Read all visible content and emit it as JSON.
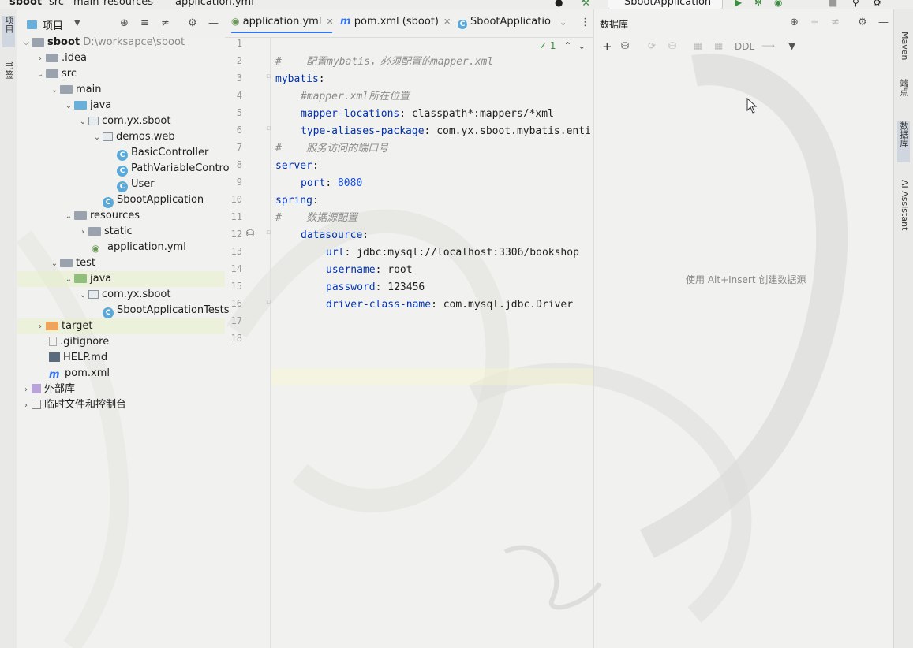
{
  "topbar": {
    "crumbs": [
      "sboot",
      "src",
      "main",
      "resources",
      "application.yml"
    ],
    "run_config": "SbootApplication"
  },
  "left_stripe": {
    "project_tab": "项目",
    "bookmarks_tab": "书签"
  },
  "project_panel": {
    "title": "项目",
    "tree": [
      {
        "label": "sboot",
        "hint": "D:\\worksapce\\sboot"
      },
      {
        "label": ".idea"
      },
      {
        "label": "src"
      },
      {
        "label": "main"
      },
      {
        "label": "java"
      },
      {
        "label": "com.yx.sboot"
      },
      {
        "label": "demos.web"
      },
      {
        "label": "BasicController"
      },
      {
        "label": "PathVariableContro"
      },
      {
        "label": "User"
      },
      {
        "label": "SbootApplication"
      },
      {
        "label": "resources"
      },
      {
        "label": "static"
      },
      {
        "label": "application.yml"
      },
      {
        "label": "test"
      },
      {
        "label": "java"
      },
      {
        "label": "com.yx.sboot"
      },
      {
        "label": "SbootApplicationTests"
      },
      {
        "label": "target"
      },
      {
        "label": ".gitignore"
      },
      {
        "label": "HELP.md"
      },
      {
        "label": "pom.xml"
      },
      {
        "label": "外部库"
      },
      {
        "label": "临时文件和控制台"
      }
    ]
  },
  "editor": {
    "tabs": [
      {
        "label": "application.yml"
      },
      {
        "label": "pom.xml (sboot)"
      },
      {
        "label": "SbootApplicatio"
      }
    ],
    "problems": "1",
    "line_numbers": [
      "1",
      "2",
      "3",
      "4",
      "5",
      "6",
      "7",
      "8",
      "9",
      "10",
      "11",
      "12",
      "13",
      "14",
      "15",
      "16",
      "17",
      "18"
    ],
    "code": {
      "l2": "#    配置mybatis，必须配置的mapper.xml",
      "l3": "mybatis",
      "l4": "#mapper.xml所在位置",
      "l5k": "mapper-locations",
      "l5v": "classpath*:mappers/*xml",
      "l6k": "type-aliases-package",
      "l6v": "com.yx.sboot.mybatis.enti",
      "l7": "#    服务访问的端口号",
      "l8": "server",
      "l9k": "port",
      "l9v": "8080",
      "l10": "spring",
      "l11": "#    数据源配置",
      "l12": "datasource",
      "l13k": "url",
      "l13v": "jdbc:mysql://localhost:3306/bookshop",
      "l14k": "username",
      "l14v": "root",
      "l15k": "password",
      "l15v": "123456",
      "l16k": "driver-class-name",
      "l16v": "com.mysql.jdbc.Driver"
    }
  },
  "db_panel": {
    "title": "数据库",
    "ddl": "DDL",
    "hint": "使用 Alt+Insert 创建数据源"
  },
  "right_stripe": {
    "maven": "Maven",
    "endpoints": "端点",
    "database": "数据库",
    "ai": "AI Assistant"
  }
}
